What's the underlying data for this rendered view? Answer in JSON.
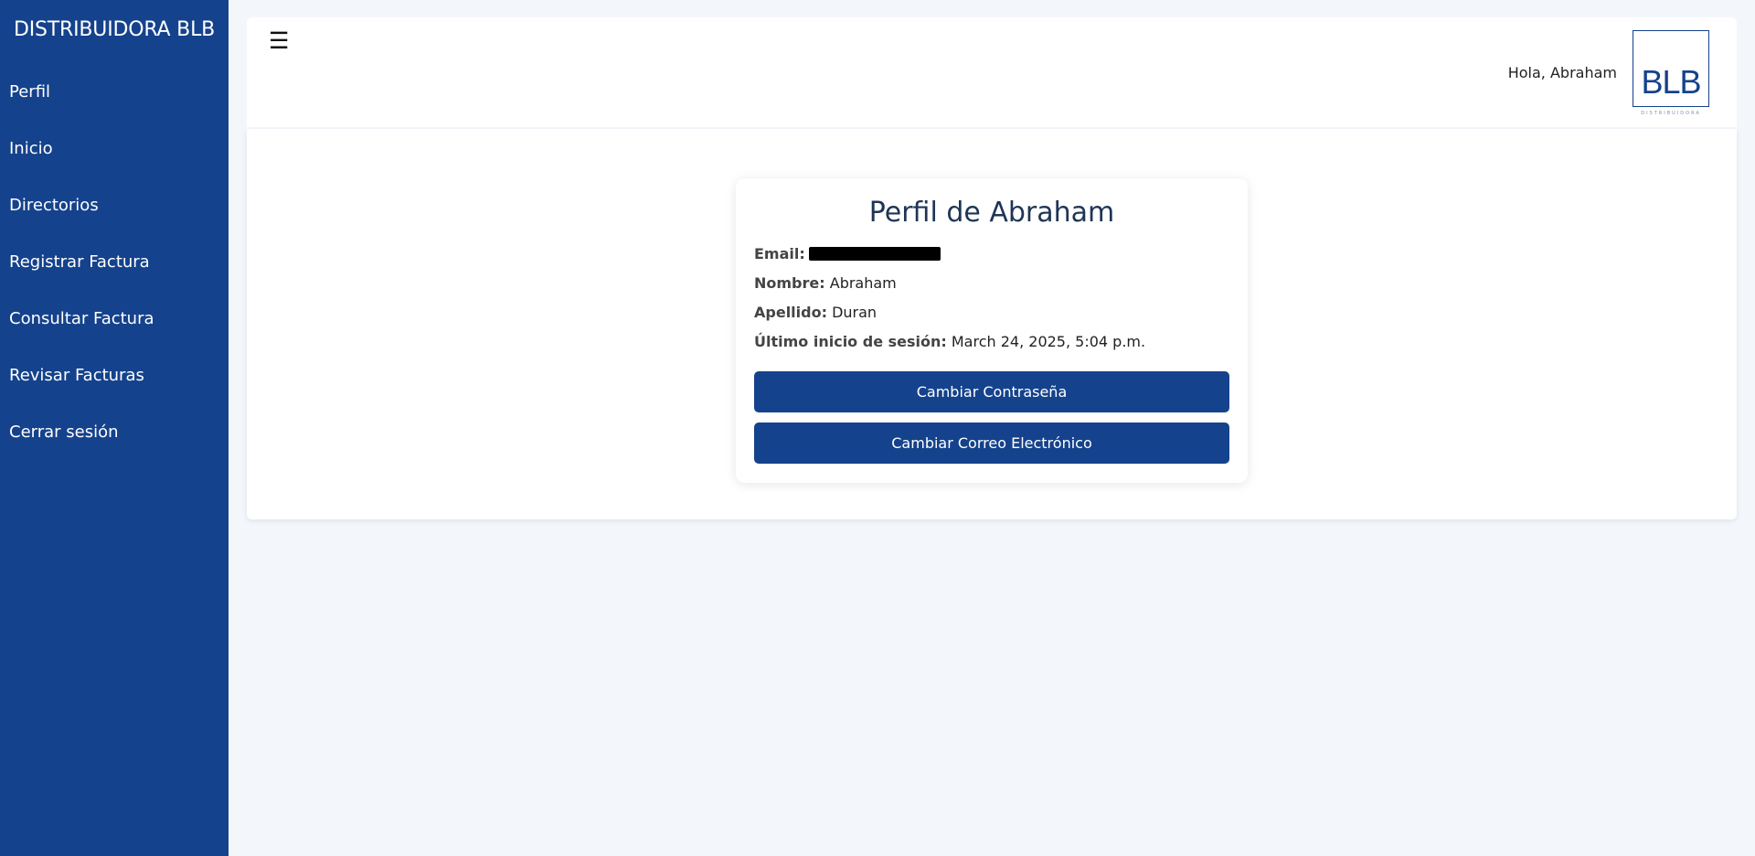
{
  "sidebar": {
    "brand": "DISTRIBUIDORA BLB",
    "items": [
      {
        "label": "Perfil"
      },
      {
        "label": "Inicio"
      },
      {
        "label": "Directorios"
      },
      {
        "label": "Registrar Factura"
      },
      {
        "label": "Consultar Factura"
      },
      {
        "label": "Revisar Facturas"
      },
      {
        "label": "Cerrar sesión"
      }
    ]
  },
  "header": {
    "menu_icon": "☰",
    "greeting": "Hola, Abraham",
    "logo_text": "BLB",
    "logo_subtext": "DISTRIBUIDORA"
  },
  "profile": {
    "title": "Perfil de Abraham",
    "email_label": "Email:",
    "nombre_label": "Nombre:",
    "nombre_value": "Abraham",
    "apellido_label": "Apellido:",
    "apellido_value": "Duran",
    "last_login_label": "Último inicio de sesión:",
    "last_login_value": "March 24, 2025, 5:04 p.m.",
    "change_password_label": "Cambiar Contraseña",
    "change_email_label": "Cambiar Correo Electrónico"
  },
  "colors": {
    "primary": "#15428c",
    "background": "#f3f6fb",
    "title": "#1f3556"
  }
}
